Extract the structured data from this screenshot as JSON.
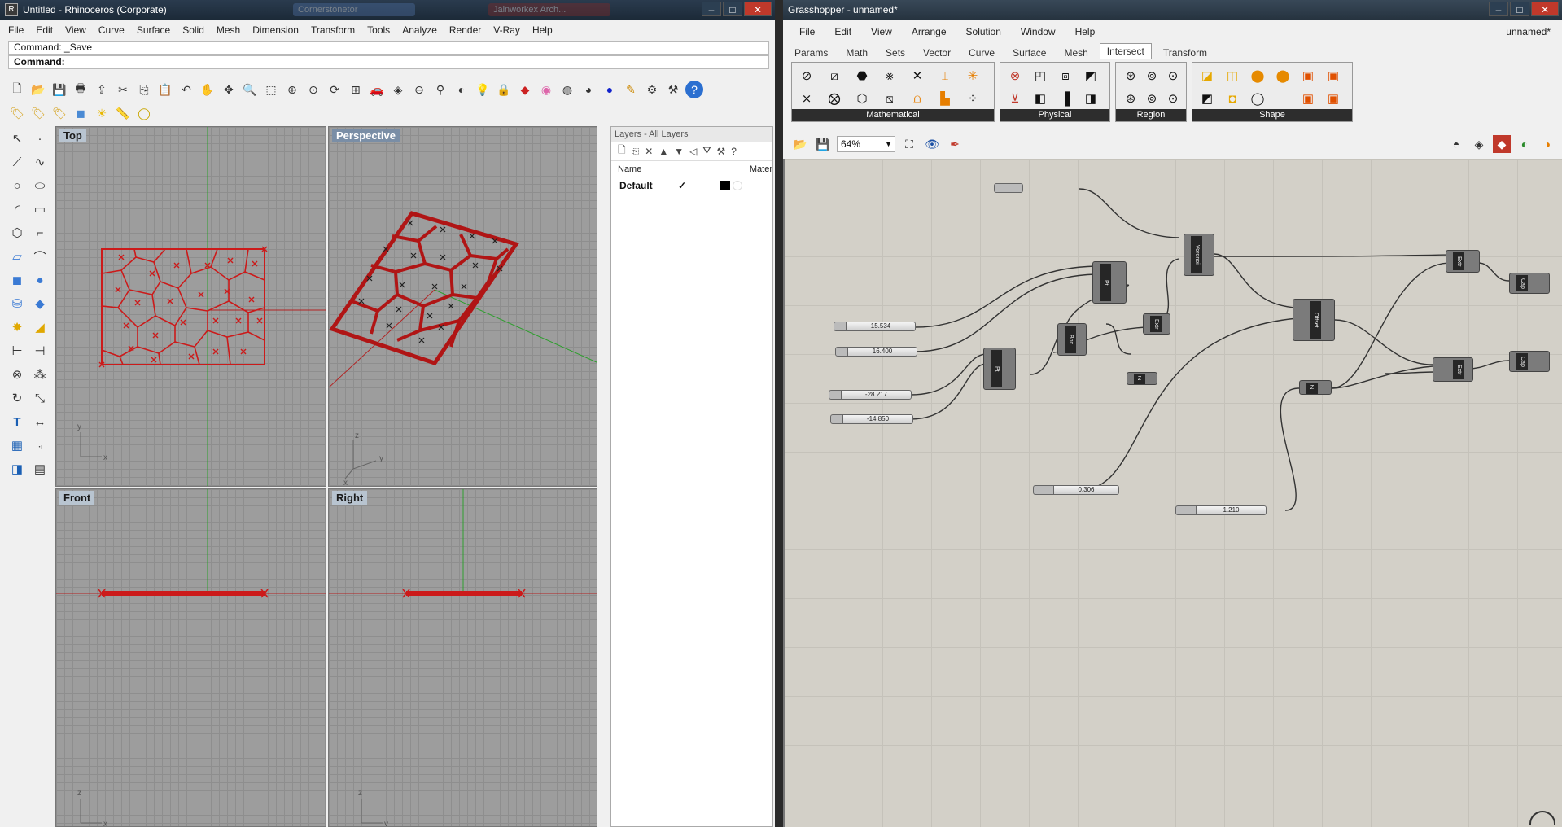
{
  "taskbar_ghosts": [
    "Cornerstonetor",
    "Jainworkex Arch..."
  ],
  "rhino": {
    "title": "Untitled - Rhinoceros (Corporate)",
    "menu": [
      "File",
      "Edit",
      "View",
      "Curve",
      "Surface",
      "Solid",
      "Mesh",
      "Dimension",
      "Transform",
      "Tools",
      "Analyze",
      "Render",
      "V-Ray",
      "Help"
    ],
    "command_history": "Command: _Save",
    "command_prompt": "Command:",
    "viewports": {
      "top": "Top",
      "perspective": "Perspective",
      "front": "Front",
      "right": "Right"
    },
    "axes": {
      "x": "x",
      "y": "y",
      "z": "z"
    },
    "layers": {
      "panel_title": "Layers - All Layers",
      "col_name": "Name",
      "col_material": "Mater",
      "rows": [
        {
          "name": "Default",
          "current": "✓"
        }
      ]
    }
  },
  "grasshopper": {
    "title": "Grasshopper - unnamed*",
    "doc_name": "unnamed*",
    "menu": [
      "File",
      "Edit",
      "View",
      "Arrange",
      "Solution",
      "Window",
      "Help"
    ],
    "tabs": [
      "Params",
      "Math",
      "Sets",
      "Vector",
      "Curve",
      "Surface",
      "Mesh",
      "Intersect",
      "Transform"
    ],
    "active_tab": "Intersect",
    "ribbon_groups": [
      "Mathematical",
      "Physical",
      "Region",
      "Shape"
    ],
    "zoom": "64%",
    "sliders": [
      "15.534",
      "16.400",
      "-28.217",
      "-14.850",
      "0.306",
      "1.210"
    ],
    "components": [
      "Voronoi",
      "Pt",
      "Box",
      "Pt",
      "Extr",
      "Offset",
      "Z",
      "Extr",
      "Extr",
      "Cap",
      "Cap"
    ]
  },
  "colors": {
    "geometry": "#cc1a1a",
    "x_axis": "#b22222",
    "y_axis": "#2e9e2e",
    "canvas": "#d3d0c8",
    "viewport": "#9d9d9d"
  }
}
